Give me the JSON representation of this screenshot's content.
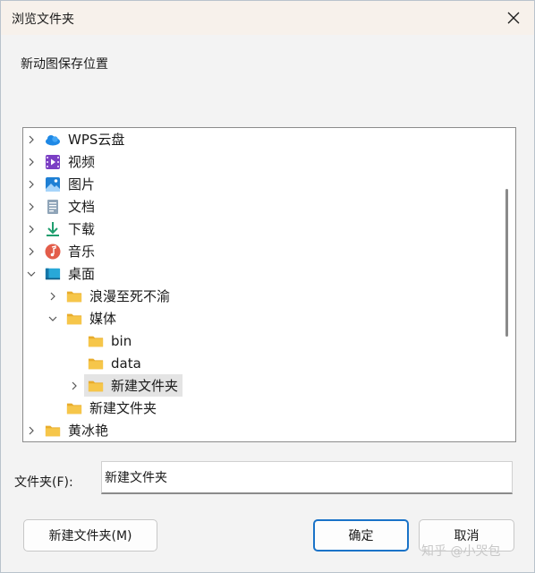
{
  "window": {
    "title": "浏览文件夹",
    "instruction": "新动图保存位置"
  },
  "tree": {
    "items": [
      {
        "label": "WPS云盘",
        "icon": "cloud-icon",
        "expanded": false
      },
      {
        "label": "视频",
        "icon": "video-icon",
        "expanded": false
      },
      {
        "label": "图片",
        "icon": "image-icon",
        "expanded": false
      },
      {
        "label": "文档",
        "icon": "document-icon",
        "expanded": false
      },
      {
        "label": "下载",
        "icon": "download-icon",
        "expanded": false
      },
      {
        "label": "音乐",
        "icon": "music-icon",
        "expanded": false
      },
      {
        "label": "桌面",
        "icon": "desktop-icon",
        "expanded": true
      },
      {
        "label": "浪漫至死不渝",
        "icon": "folder-icon",
        "expanded": false
      },
      {
        "label": "媒体",
        "icon": "folder-icon",
        "expanded": true
      },
      {
        "label": "bin",
        "icon": "folder-icon"
      },
      {
        "label": "data",
        "icon": "folder-icon"
      },
      {
        "label": "新建文件夹",
        "icon": "folder-icon",
        "expanded": false,
        "selected": true
      },
      {
        "label": "新建文件夹",
        "icon": "folder-icon"
      },
      {
        "label": "黄冰艳",
        "icon": "folder-icon",
        "expanded": false
      }
    ]
  },
  "folder_field": {
    "label": "文件夹(F):",
    "value": "新建文件夹"
  },
  "buttons": {
    "new_folder": "新建文件夹(M)",
    "ok": "确定",
    "cancel": "取消"
  },
  "watermark": "知乎 @小哭包",
  "colors": {
    "accent": "#1a73c8",
    "folder": "#f6c64a"
  }
}
